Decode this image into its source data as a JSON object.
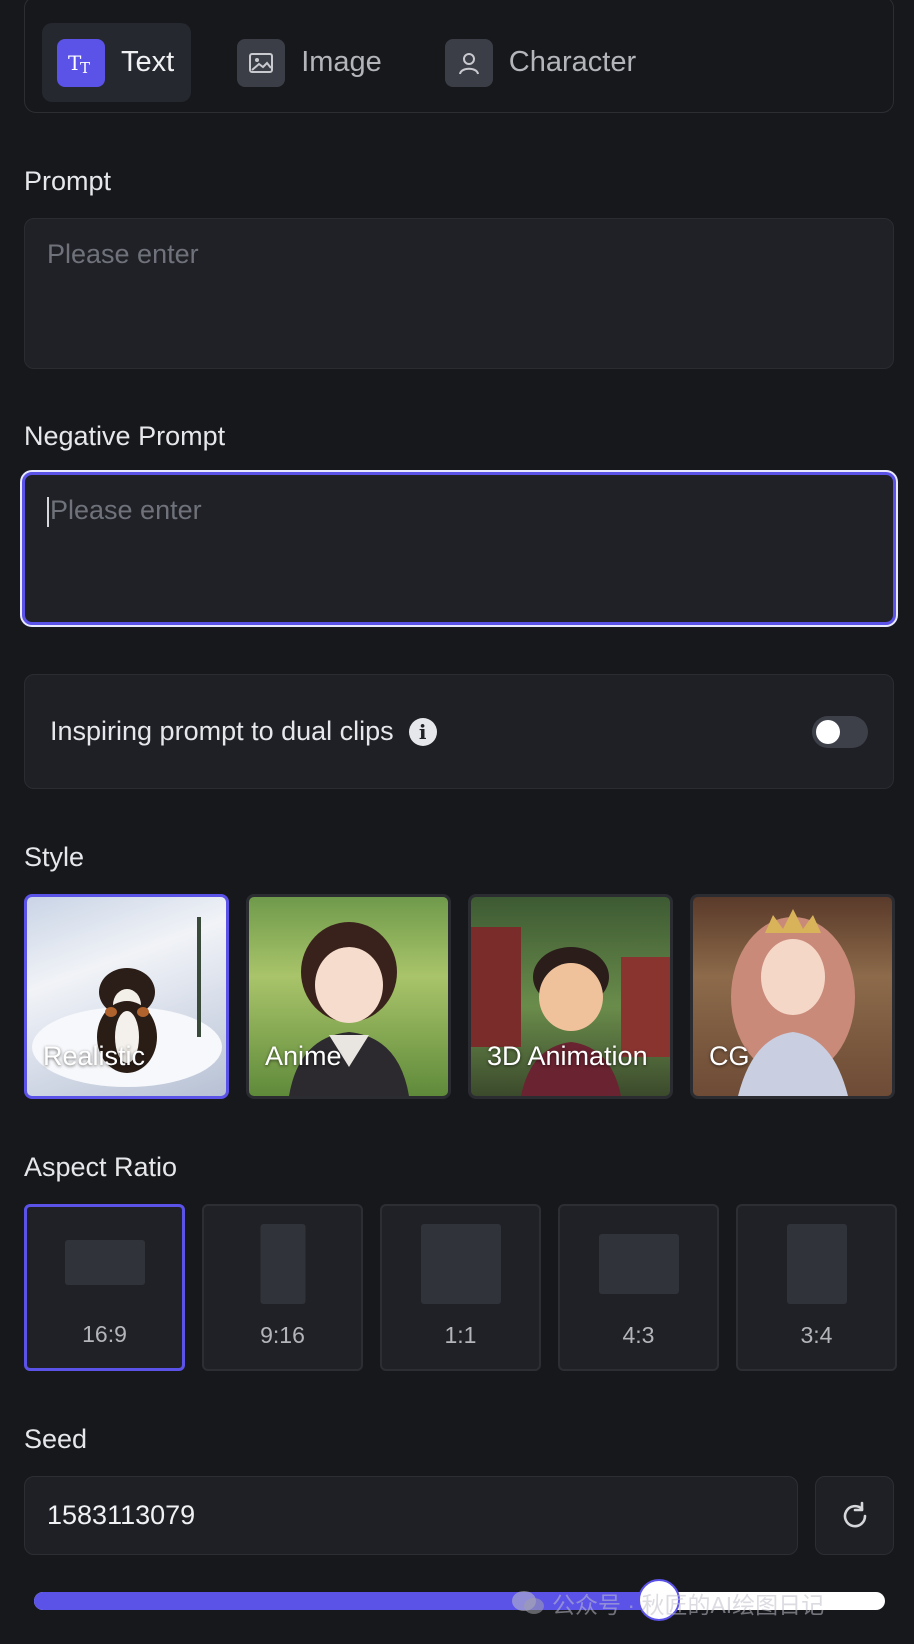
{
  "modes": [
    {
      "label": "Text",
      "icon": "text-type-icon",
      "active": true
    },
    {
      "label": "Image",
      "icon": "image-icon",
      "active": false
    },
    {
      "label": "Character",
      "icon": "character-icon",
      "active": false
    }
  ],
  "prompt": {
    "label": "Prompt",
    "placeholder": "Please enter",
    "value": ""
  },
  "negative_prompt": {
    "label": "Negative Prompt",
    "placeholder": "Please enter",
    "value": ""
  },
  "dual_clips": {
    "label": "Inspiring prompt to dual clips",
    "enabled": false
  },
  "style": {
    "label": "Style",
    "options": [
      {
        "label": "Realistic",
        "selected": true
      },
      {
        "label": "Anime",
        "selected": false
      },
      {
        "label": "3D Animation",
        "selected": false
      },
      {
        "label": "CG",
        "selected": false
      }
    ]
  },
  "aspect_ratio": {
    "label": "Aspect Ratio",
    "options": [
      {
        "label": "16:9",
        "selected": true
      },
      {
        "label": "9:16",
        "selected": false
      },
      {
        "label": "1:1",
        "selected": false
      },
      {
        "label": "4:3",
        "selected": false
      },
      {
        "label": "3:4",
        "selected": false
      }
    ]
  },
  "seed": {
    "label": "Seed",
    "value": "1583113079",
    "slider_fraction": 0.735
  },
  "watermark": "公众号 · 秋匠的AI绘图日记",
  "colors": {
    "accent": "#5b52e8",
    "background": "#17181c",
    "panel": "#1f2026"
  }
}
